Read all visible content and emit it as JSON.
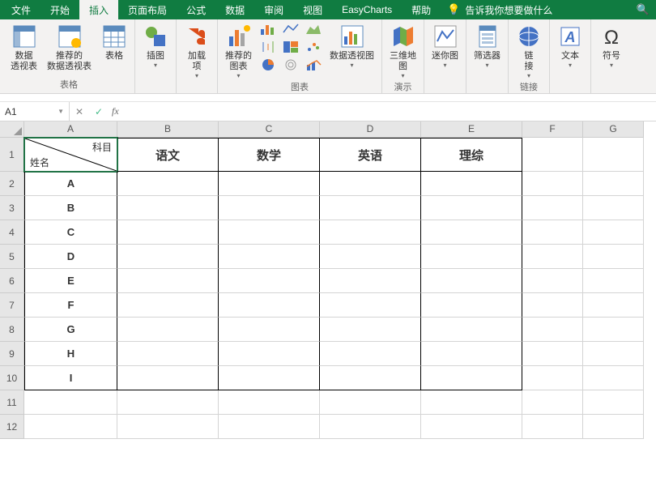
{
  "tabs": {
    "file": "文件",
    "home": "开始",
    "insert": "插入",
    "layout": "页面布局",
    "formula": "公式",
    "data": "数据",
    "review": "审阅",
    "view": "视图",
    "ec": "EasyCharts",
    "help": "帮助",
    "tellme": "告诉我你想要做什么"
  },
  "ribbon": {
    "pivot": "数据\n透视表",
    "recpivot": "推荐的\n数据透视表",
    "table": "表格",
    "illus": "插图",
    "addin": "加载\n项",
    "recchart": "推荐的\n图表",
    "pivotchart": "数据透视图",
    "map3d": "三维地\n图",
    "spark": "迷你图",
    "slicer": "筛选器",
    "link": "链\n接",
    "text": "文本",
    "symbol": "符号",
    "g_tables": "表格",
    "g_charts": "图表",
    "g_demo": "演示",
    "g_link": "链接"
  },
  "namebox": "A1",
  "sheet": {
    "cols": [
      "A",
      "B",
      "C",
      "D",
      "E",
      "F",
      "G"
    ],
    "diag_top": "科目",
    "diag_bottom": "姓名",
    "headers": [
      "语文",
      "数学",
      "英语",
      "理综"
    ],
    "rows": [
      "A",
      "B",
      "C",
      "D",
      "E",
      "F",
      "G",
      "H",
      "I"
    ]
  }
}
